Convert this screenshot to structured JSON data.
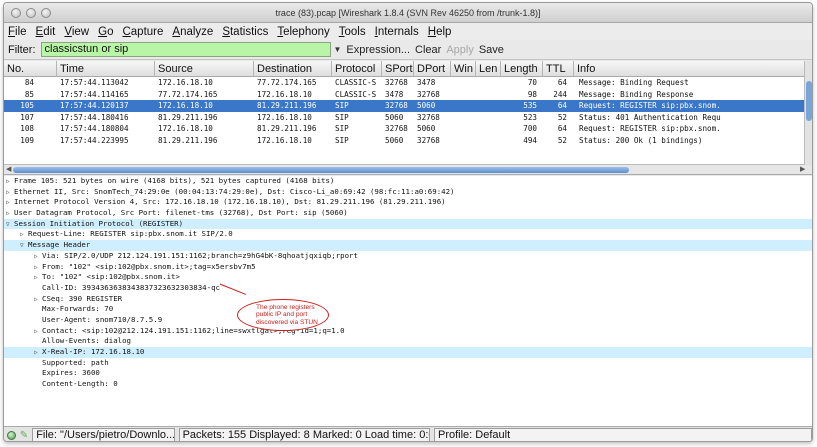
{
  "window": {
    "title": "trace (83).pcap  [Wireshark 1.8.4  (SVN Rev 46250 from /trunk-1.8)]"
  },
  "menu": [
    "File",
    "Edit",
    "View",
    "Go",
    "Capture",
    "Analyze",
    "Statistics",
    "Telephony",
    "Tools",
    "Internals",
    "Help"
  ],
  "filter": {
    "label": "Filter:",
    "value": "classicstun or sip",
    "expression": "Expression...",
    "clear": "Clear",
    "apply": "Apply",
    "save": "Save"
  },
  "packet_list": {
    "columns": [
      "No.",
      "Time",
      "Source",
      "Destination",
      "Protocol",
      "SPort",
      "DPort",
      "Win",
      "Len",
      "Length",
      "TTL",
      "Info"
    ],
    "rows": [
      {
        "no": "84",
        "time": "17:57:44.113042",
        "src": "172.16.18.10",
        "dst": "77.72.174.165",
        "proto": "CLASSIC-S",
        "sport": "32768",
        "dport": "3478",
        "length": "70",
        "ttl": "64",
        "info": "Message: Binding Request"
      },
      {
        "no": "85",
        "time": "17:57:44.114165",
        "src": "77.72.174.165",
        "dst": "172.16.18.10",
        "proto": "CLASSIC-S",
        "sport": "3478",
        "dport": "32768",
        "length": "98",
        "ttl": "244",
        "info": "Message: Binding Response"
      },
      {
        "no": "105",
        "time": "17:57:44.120137",
        "src": "172.16.18.10",
        "dst": "81.29.211.196",
        "proto": "SIP",
        "sport": "32768",
        "dport": "5060",
        "length": "535",
        "ttl": "64",
        "info": "Request: REGISTER sip:pbx.snom."
      },
      {
        "no": "107",
        "time": "17:57:44.180416",
        "src": "81.29.211.196",
        "dst": "172.16.18.10",
        "proto": "SIP",
        "sport": "5060",
        "dport": "32768",
        "length": "523",
        "ttl": "52",
        "info": "Status: 401 Authentication Requ"
      },
      {
        "no": "108",
        "time": "17:57:44.180804",
        "src": "172.16.18.10",
        "dst": "81.29.211.196",
        "proto": "SIP",
        "sport": "32768",
        "dport": "5060",
        "length": "700",
        "ttl": "64",
        "info": "Request: REGISTER sip:pbx.snom."
      },
      {
        "no": "109",
        "time": "17:57:44.223995",
        "src": "81.29.211.196",
        "dst": "172.16.18.10",
        "proto": "SIP",
        "sport": "5060",
        "dport": "32768",
        "length": "494",
        "ttl": "52",
        "info": "Status: 200 Ok     (1 bindings)"
      }
    ],
    "selected_no": "105"
  },
  "details": [
    {
      "indent": 0,
      "toggle": "collapsed",
      "text": "Frame 105: 521 bytes on wire (4168 bits), 521 bytes captured (4168 bits)"
    },
    {
      "indent": 0,
      "toggle": "collapsed",
      "text": "Ethernet II, Src: SnomTech_74:29:0e (00:04:13:74:29:0e), Dst: Cisco-Li_a0:69:42 (98:fc:11:a0:69:42)"
    },
    {
      "indent": 0,
      "toggle": "collapsed",
      "text": "Internet Protocol Version 4, Src: 172.16.18.10 (172.16.18.10), Dst: 81.29.211.196 (81.29.211.196)"
    },
    {
      "indent": 0,
      "toggle": "collapsed",
      "text": "User Datagram Protocol, Src Port: filenet-tms (32768), Dst Port: sip (5060)"
    },
    {
      "indent": 0,
      "toggle": "expanded",
      "text": "Session Initiation Protocol (REGISTER)",
      "highlight": true
    },
    {
      "indent": 1,
      "toggle": "collapsed",
      "text": "Request-Line: REGISTER sip:pbx.snom.it SIP/2.0"
    },
    {
      "indent": 1,
      "toggle": "expanded",
      "text": "Message Header",
      "highlight": true
    },
    {
      "indent": 2,
      "toggle": "collapsed",
      "text": "Via: SIP/2.0/UDP 212.124.191.151:1162;branch=z9hG4bK-8qhoatjqxiqb;rport"
    },
    {
      "indent": 2,
      "toggle": "collapsed",
      "text": "From: \"102\" <sip:102@pbx.snom.it>;tag=x5ersbv7m5"
    },
    {
      "indent": 2,
      "toggle": "collapsed",
      "text": "To: \"102\" <sip:102@pbx.snom.it>"
    },
    {
      "indent": 2,
      "toggle": "none",
      "text": "Call-ID: 3934363638343837323632303834-qc"
    },
    {
      "indent": 2,
      "toggle": "collapsed",
      "text": "CSeq: 390 REGISTER"
    },
    {
      "indent": 2,
      "toggle": "none",
      "text": "Max-Forwards: 70"
    },
    {
      "indent": 2,
      "toggle": "none",
      "text": "User-Agent: snom710/8.7.5.9"
    },
    {
      "indent": 2,
      "toggle": "collapsed",
      "text": "Contact: <sip:102@212.124.191.151:1162;line=swxtlgal>;reg-id=1;q=1.0"
    },
    {
      "indent": 2,
      "toggle": "none",
      "text": "Allow-Events: dialog"
    },
    {
      "indent": 2,
      "toggle": "collapsed",
      "text": "X-Real-IP: 172.16.18.10",
      "highlight": true
    },
    {
      "indent": 2,
      "toggle": "none",
      "text": "Supported: path"
    },
    {
      "indent": 2,
      "toggle": "none",
      "text": "Expires: 3600"
    },
    {
      "indent": 2,
      "toggle": "none",
      "text": "Content-Length: 0"
    }
  ],
  "annotation": {
    "text": "The phone registers public IP and port discovered via STUN"
  },
  "status": {
    "file": "File: \"/Users/pietro/Downlo...",
    "packets": "Packets: 155 Displayed: 8 Marked: 0 Load time: 0:00.0...",
    "profile": "Profile: Default"
  },
  "colors": {
    "filter_valid": "#b9f5a6",
    "selected_row": "#3a77c8",
    "detail_highlight": "#cfeeff",
    "annotation": "#c8201b"
  }
}
